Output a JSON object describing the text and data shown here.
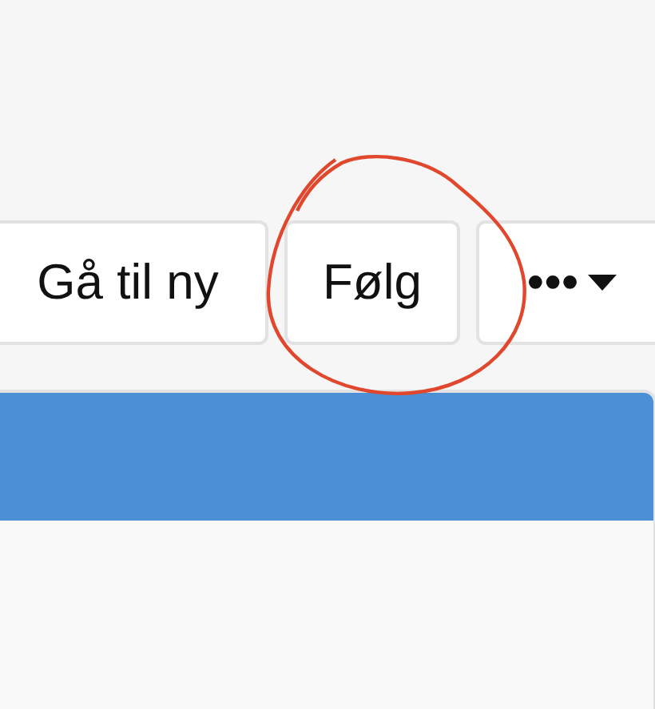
{
  "toolbar": {
    "buttons": [
      {
        "kind": "text",
        "label": "Gå til ny",
        "circled": false
      },
      {
        "kind": "text",
        "label": "Følg",
        "circled": true
      },
      {
        "kind": "menu",
        "label": "•••",
        "circled": false
      }
    ]
  },
  "annotation": {
    "kind": "circle"
  },
  "panel": {
    "header": {
      "kind": "bar"
    }
  }
}
